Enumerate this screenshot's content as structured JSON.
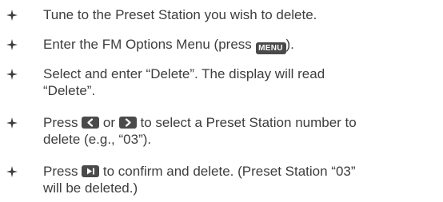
{
  "steps": [
    {
      "segments": [
        "Tune to the Preset Station you wish to delete."
      ]
    },
    {
      "segments": [
        "Enter the FM Options Menu (press ",
        ")."
      ],
      "key_label": "MENU"
    },
    {
      "segments": [
        "Select and enter “Delete”. The display will read",
        "“Delete”."
      ]
    },
    {
      "segments": [
        "Press ",
        " or ",
        " to select a Preset Station number to",
        "delete (e.g., “03”)."
      ]
    },
    {
      "segments": [
        "Press ",
        " to confirm and delete. (Preset Station “03”",
        "will be deleted.)"
      ]
    }
  ],
  "icons": {
    "bullet": "four-point-star-icon",
    "left_key": "left-arrow-key-icon",
    "right_key": "right-arrow-key-icon",
    "play_key": "play-pause-key-icon"
  },
  "colors": {
    "text": "#3d3d3d",
    "key_fill": "#4a4a4a",
    "key_symbol": "#ffffff"
  }
}
